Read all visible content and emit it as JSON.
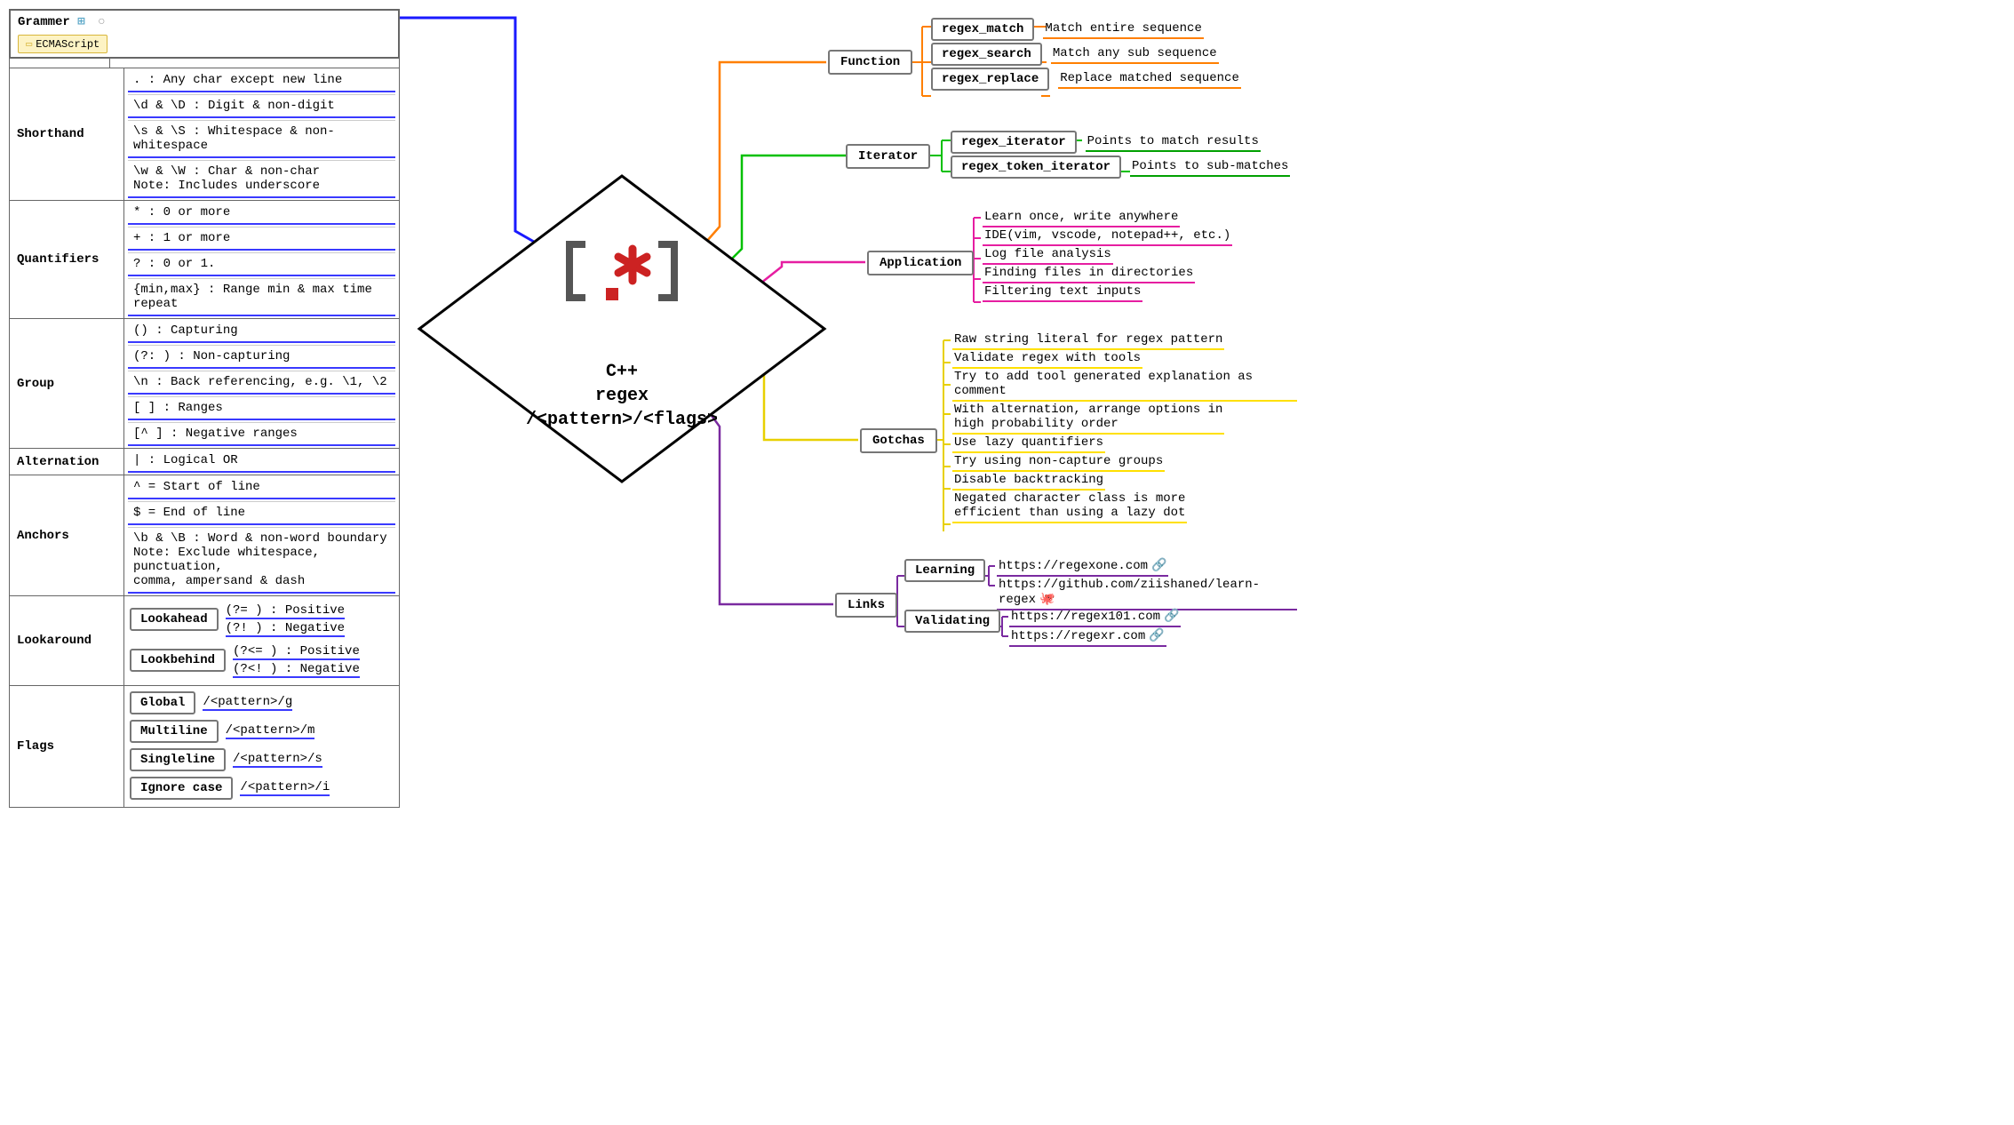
{
  "grammar": {
    "title": "Grammer",
    "tag": "ECMAScript",
    "sections": {
      "shorthand": {
        "label": "Shorthand",
        "items": [
          ". : Any char except new line",
          "\\d & \\D : Digit & non-digit",
          "\\s & \\S : Whitespace & non-whitespace",
          "\\w & \\W : Char & non-char\nNote: Includes underscore"
        ]
      },
      "quantifiers": {
        "label": "Quantifiers",
        "items": [
          "* : 0 or more",
          "+ : 1 or more",
          "? : 0 or 1.",
          "{min,max} : Range min & max time repeat"
        ]
      },
      "group": {
        "label": "Group",
        "items": [
          "() : Capturing",
          "(?: ) : Non-capturing",
          "\\n : Back referencing, e.g. \\1, \\2",
          "[ ] : Ranges",
          "[^ ] : Negative ranges"
        ]
      },
      "alternation": {
        "label": "Alternation",
        "items": [
          "| : Logical OR"
        ]
      },
      "anchors": {
        "label": "Anchors",
        "items": [
          "^ = Start  of line",
          "$ = End of line",
          "\\b & \\B : Word & non-word boundary\nNote: Exclude whitespace, punctuation,\ncomma, ampersand & dash"
        ]
      },
      "lookaround": {
        "label": "Lookaround",
        "lookahead": {
          "label": "Lookahead",
          "pos": "(?= ) : Positive",
          "neg": "(?! ) : Negative"
        },
        "lookbehind": {
          "label": "Lookbehind",
          "pos": "(?<= ) : Positive",
          "neg": "(?<! ) : Negative"
        }
      },
      "flags": {
        "label": "Flags",
        "items": [
          {
            "name": "Global",
            "val": "/<pattern>/g"
          },
          {
            "name": "Multiline",
            "val": "/<pattern>/m"
          },
          {
            "name": "Singleline",
            "val": "/<pattern>/s"
          },
          {
            "name": "Ignore case",
            "val": "/<pattern>/i"
          }
        ]
      }
    }
  },
  "center": {
    "title": "C++\nregex\n/<pattern>/<flags>"
  },
  "function": {
    "label": "Function",
    "items": [
      {
        "name": "regex_match",
        "desc": "Match entire sequence"
      },
      {
        "name": "regex_search",
        "desc": "Match any sub sequence"
      },
      {
        "name": "regex_replace",
        "desc": "Replace matched sequence"
      }
    ]
  },
  "iterator": {
    "label": "Iterator",
    "items": [
      {
        "name": "regex_iterator",
        "desc": "Points to match results"
      },
      {
        "name": "regex_token_iterator",
        "desc": "Points to sub-matches"
      }
    ]
  },
  "application": {
    "label": "Application",
    "items": [
      "Learn once, write anywhere",
      "IDE(vim, vscode, notepad++, etc.)",
      "Log file analysis",
      "Finding files in directories",
      "Filtering text inputs"
    ]
  },
  "gotchas": {
    "label": "Gotchas",
    "items": [
      "Raw string literal for regex pattern",
      "Validate regex with tools",
      "Try to add tool generated explanation as comment",
      "With alternation, arrange options in\nhigh probability order",
      "Use lazy quantifiers",
      "Try using non-capture groups",
      "Disable backtracking",
      "Negated character class is more\nefficient than using a lazy dot"
    ]
  },
  "links": {
    "label": "Links",
    "learning": {
      "label": "Learning",
      "items": [
        "https://regexone.com",
        "https://github.com/ziishaned/learn-regex"
      ]
    },
    "validating": {
      "label": "Validating",
      "items": [
        "https://regex101.com",
        "https://regexr.com"
      ]
    }
  },
  "colors": {
    "blue": "#1a1aff",
    "orange": "#ff7f00",
    "green": "#00a000",
    "magenta": "#e61ea1",
    "yellow": "#e8d000",
    "purple": "#7a2aa0"
  },
  "chart_data": {
    "type": "mindmap",
    "root": {
      "label": "C++ regex /<pattern>/<flags>",
      "icon": "regex-bracket-icon"
    },
    "branches": [
      {
        "side": "left",
        "color": "blue",
        "label": "Grammer",
        "tag": "ECMAScript",
        "children": [
          {
            "label": "Shorthand",
            "children": [
              ". : Any char except new line",
              "\\d & \\D : Digit & non-digit",
              "\\s & \\S : Whitespace & non-whitespace",
              "\\w & \\W : Char & non-char (Includes underscore)"
            ]
          },
          {
            "label": "Quantifiers",
            "children": [
              "* : 0 or more",
              "+ : 1 or more",
              "? : 0 or 1.",
              "{min,max} : Range min & max time repeat"
            ]
          },
          {
            "label": "Group",
            "children": [
              "() : Capturing",
              "(?: ) : Non-capturing",
              "\\n : Back referencing, e.g. \\1, \\2",
              "[ ] : Ranges",
              "[^ ] : Negative ranges"
            ]
          },
          {
            "label": "Alternation",
            "children": [
              "| : Logical OR"
            ]
          },
          {
            "label": "Anchors",
            "children": [
              "^ = Start of line",
              "$ = End of line",
              "\\b & \\B : Word & non-word boundary (Exclude whitespace, punctuation, comma, ampersand & dash)"
            ]
          },
          {
            "label": "Lookaround",
            "children": [
              {
                "label": "Lookahead",
                "children": [
                  "(?= ) : Positive",
                  "(?! ) : Negative"
                ]
              },
              {
                "label": "Lookbehind",
                "children": [
                  "(?<= ) : Positive",
                  "(?<! ) : Negative"
                ]
              }
            ]
          },
          {
            "label": "Flags",
            "children": [
              {
                "label": "Global",
                "value": "/<pattern>/g"
              },
              {
                "label": "Multiline",
                "value": "/<pattern>/m"
              },
              {
                "label": "Singleline",
                "value": "/<pattern>/s"
              },
              {
                "label": "Ignore case",
                "value": "/<pattern>/i"
              }
            ]
          }
        ]
      },
      {
        "side": "right",
        "color": "orange",
        "label": "Function",
        "children": [
          {
            "label": "regex_match",
            "value": "Match entire sequence"
          },
          {
            "label": "regex_search",
            "value": "Match any sub sequence"
          },
          {
            "label": "regex_replace",
            "value": "Replace matched sequence"
          }
        ]
      },
      {
        "side": "right",
        "color": "green",
        "label": "Iterator",
        "children": [
          {
            "label": "regex_iterator",
            "value": "Points to match results"
          },
          {
            "label": "regex_token_iterator",
            "value": "Points to sub-matches"
          }
        ]
      },
      {
        "side": "right",
        "color": "magenta",
        "label": "Application",
        "children": [
          "Learn once, write anywhere",
          "IDE(vim, vscode, notepad++, etc.)",
          "Log file analysis",
          "Finding files in directories",
          "Filtering text inputs"
        ]
      },
      {
        "side": "right",
        "color": "yellow",
        "label": "Gotchas",
        "children": [
          "Raw string literal for regex pattern",
          "Validate regex with tools",
          "Try to add tool generated explanation as comment",
          "With alternation, arrange options in high probability order",
          "Use lazy quantifiers",
          "Try using non-capture groups",
          "Disable backtracking",
          "Negated character class is more efficient than using a lazy dot"
        ]
      },
      {
        "side": "right",
        "color": "purple",
        "label": "Links",
        "children": [
          {
            "label": "Learning",
            "children": [
              "https://regexone.com",
              "https://github.com/ziishaned/learn-regex"
            ]
          },
          {
            "label": "Validating",
            "children": [
              "https://regex101.com",
              "https://regexr.com"
            ]
          }
        ]
      }
    ]
  }
}
